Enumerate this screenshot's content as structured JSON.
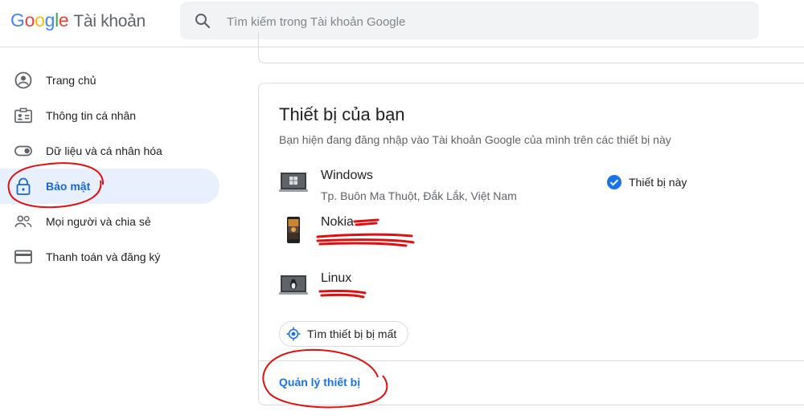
{
  "header": {
    "logo_letters": [
      "G",
      "o",
      "o",
      "g",
      "l",
      "e"
    ],
    "product": "Tài khoản",
    "search_placeholder": "Tìm kiếm trong Tài khoản Google"
  },
  "nav": {
    "items": [
      {
        "label": "Trang chủ",
        "icon": "account-circle-icon"
      },
      {
        "label": "Thông tin cá nhân",
        "icon": "id-card-icon"
      },
      {
        "label": "Dữ liệu và cá nhân hóa",
        "icon": "toggle-icon"
      },
      {
        "label": "Bảo mật",
        "icon": "lock-icon",
        "active": true
      },
      {
        "label": "Mọi người và chia sẻ",
        "icon": "people-icon"
      },
      {
        "label": "Thanh toán và đăng ký",
        "icon": "credit-card-icon"
      }
    ]
  },
  "devices_card": {
    "title": "Thiết bị của bạn",
    "subtitle": "Bạn hiện đang đăng nhập vào Tài khoản Google của mình trên các thiết bị này",
    "devices": [
      {
        "name": "Windows",
        "location": "Tp. Buôn Ma Thuột, Đắk Lắk, Việt Nam",
        "icon": "laptop-windows-icon"
      },
      {
        "name": "Nokia",
        "location": "",
        "icon": "phone-icon"
      },
      {
        "name": "Linux",
        "location": "",
        "icon": "laptop-linux-icon"
      }
    ],
    "this_device_label": "Thiết bị này",
    "find_device_button": "Tìm thiết bị bị mất",
    "manage_link": "Quản lý thiết bị"
  },
  "colors": {
    "accent": "#1a73e8",
    "active_bg": "#e8f0fe",
    "annotation": "#e01010"
  }
}
